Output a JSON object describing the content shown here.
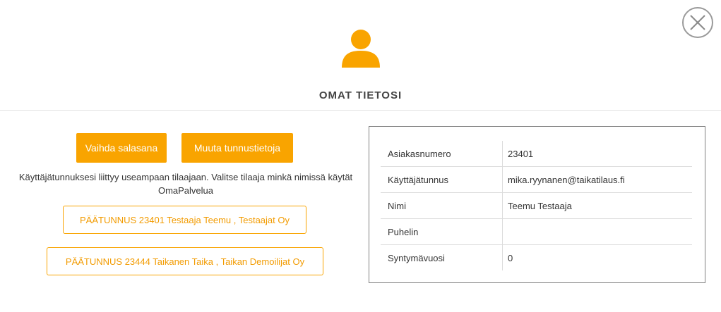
{
  "dialog": {
    "title": "OMAT TIETOSI",
    "accent_color": "#f9a400",
    "icons": {
      "close": "close-icon",
      "avatar": "user-icon"
    }
  },
  "actions": {
    "change_password": "Vaihda salasana",
    "edit_credentials": "Muuta tunnustietoja"
  },
  "info_text": "Käyttäjätunnuksesi liittyy useampaan tilaajaan. Valitse tilaaja minkä nimissä käytät OmaPalvelua",
  "accounts": [
    {
      "label": "PÄÄTUNNUS 23401 Testaaja Teemu , Testaajat Oy"
    },
    {
      "label": "PÄÄTUNNUS 23444 Taikanen Taika , Taikan Demoilijat Oy"
    }
  ],
  "details": [
    {
      "label": "Asiakasnumero",
      "value": "23401"
    },
    {
      "label": "Käyttäjätunnus",
      "value": "mika.ryynanen@taikatilaus.fi"
    },
    {
      "label": "Nimi",
      "value": "Teemu Testaaja"
    },
    {
      "label": "Puhelin",
      "value": ""
    },
    {
      "label": "Syntymävuosi",
      "value": "0"
    }
  ]
}
